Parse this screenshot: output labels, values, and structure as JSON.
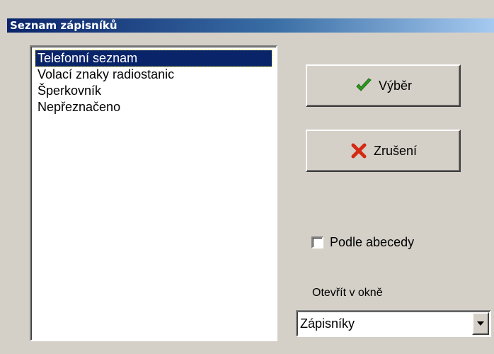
{
  "window": {
    "title": "Seznam zápisníků"
  },
  "list": {
    "items": [
      {
        "label": "Telefonní seznam",
        "selected": true
      },
      {
        "label": "Volací znaky radiostanic",
        "selected": false
      },
      {
        "label": "Šperkovník",
        "selected": false
      },
      {
        "label": "Nepřeznačeno",
        "selected": false
      }
    ]
  },
  "buttons": {
    "ok_label": "Výběr",
    "ok_icon": "checkmark-icon",
    "cancel_label": "Zrušení",
    "cancel_icon": "cross-icon"
  },
  "options": {
    "alphabetical_label": "Podle abecedy",
    "alphabetical_checked": false
  },
  "open_in": {
    "label": "Otevřít v okně",
    "selected_value": "Zápisníky"
  },
  "colors": {
    "selection": "#0a246a",
    "ok_icon": "#2e9a1e",
    "cancel_icon": "#d42a14"
  }
}
